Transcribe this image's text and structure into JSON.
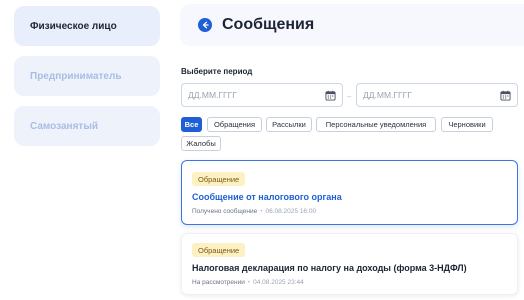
{
  "sidebar": {
    "items": [
      {
        "label": "Физическое лицо"
      },
      {
        "label": "Предприниматель"
      },
      {
        "label": "Самозанятый"
      }
    ]
  },
  "header": {
    "title": "Сообщения",
    "back_icon": "arrow-left-icon"
  },
  "period": {
    "label": "Выберите период",
    "from_placeholder": "ДД.ММ.ГГГГ",
    "to_placeholder": "ДД.ММ.ГГГГ",
    "separator": "–",
    "icon": "calendar-icon"
  },
  "filters": [
    {
      "label": "Все",
      "active": true
    },
    {
      "label": "Обращения"
    },
    {
      "label": "Рассылки"
    },
    {
      "label": "Персональные уведомления"
    },
    {
      "label": "Черновики"
    },
    {
      "label": "Жалобы"
    }
  ],
  "messages": [
    {
      "badge": "Обращение",
      "title": "Сообщение от налогового органа",
      "status": "Получено сообщение",
      "date": "06.08.2025 16:00",
      "selected": true
    },
    {
      "badge": "Обращение",
      "title": "Налоговая декларация по налогу на доходы (форма 3-НДФЛ)",
      "status": "На рассмотрении",
      "date": "04.08.2025 23:44"
    }
  ],
  "colors": {
    "accent": "#1f5fd6",
    "badge_bg": "#fdf1c4",
    "sidebar_inactive_text": "#a9bde3"
  }
}
